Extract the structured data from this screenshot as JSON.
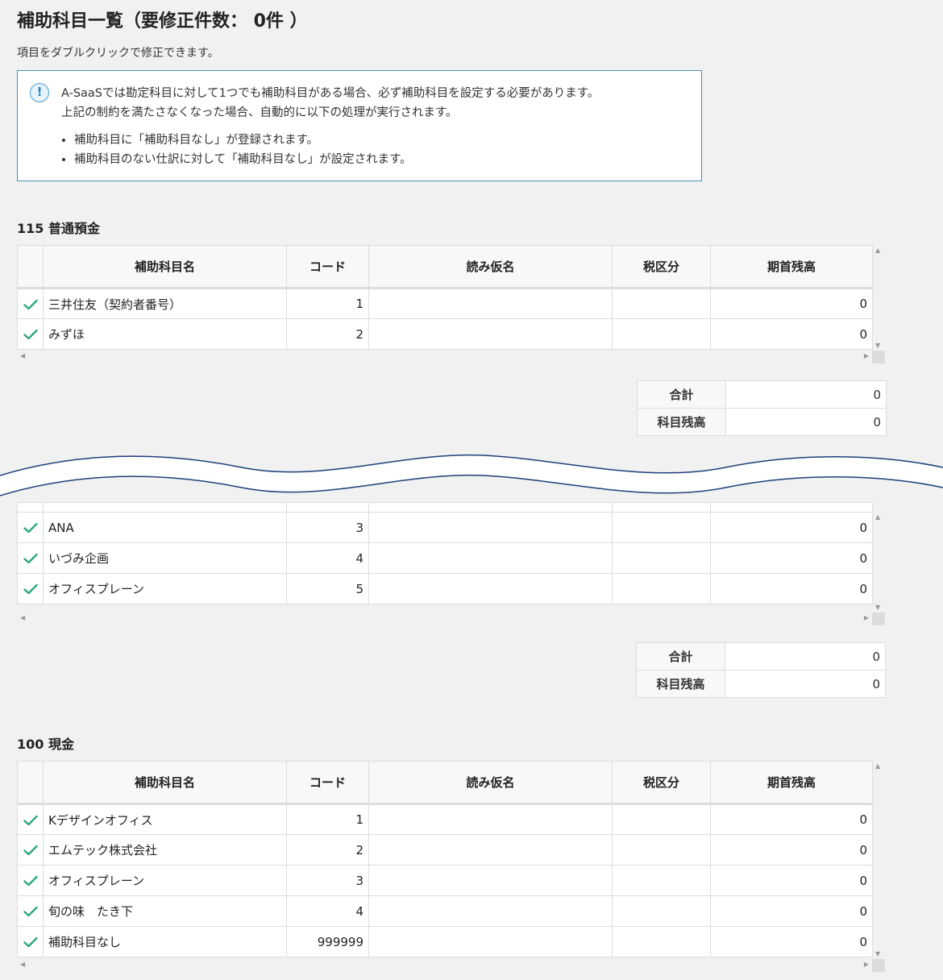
{
  "header": {
    "title": "補助科目一覧（要修正件数： 0件 ）",
    "subtitle": "項目をダブルクリックで修正できます。"
  },
  "notice": {
    "icon": "info-icon",
    "line1": "A-SaaSでは勘定科目に対して1つでも補助科目がある場合、必ず補助科目を設定する必要があります。",
    "line2": "上記の制約を満たさなくなった場合、自動的に以下の処理が実行されます。",
    "bullets": [
      "補助科目に「補助科目なし」が登録されます。",
      "補助科目のない仕訳に対して「補助科目なし」が設定されます。"
    ]
  },
  "columns": [
    "補助科目名",
    "コード",
    "読み仮名",
    "税区分",
    "期首残高"
  ],
  "colors": {
    "check": "#2aa87b",
    "border": "#dcdcdc",
    "wave": "#1e3f7a"
  },
  "sections": [
    {
      "title": "115 普通預金",
      "rows": [
        {
          "name": "三井住友（契約者番号）",
          "code": "1",
          "kana": "",
          "tax": "",
          "balance": "0"
        },
        {
          "name": "みずほ",
          "code": "2",
          "kana": "",
          "tax": "",
          "balance": "0"
        }
      ],
      "total_label": "合計",
      "total": "0",
      "balance_label": "科目残高",
      "balance": "0"
    },
    {
      "title": "",
      "rows": [
        {
          "name": "ANA",
          "code": "3",
          "kana": "",
          "tax": "",
          "balance": "0"
        },
        {
          "name": "いづみ企画",
          "code": "4",
          "kana": "",
          "tax": "",
          "balance": "0"
        },
        {
          "name": "オフィスプレーン",
          "code": "5",
          "kana": "",
          "tax": "",
          "balance": "0"
        }
      ],
      "total_label": "合計",
      "total": "0",
      "balance_label": "科目残高",
      "balance": "0"
    },
    {
      "title": "100 現金",
      "rows": [
        {
          "name": "Kデザインオフィス",
          "code": "1",
          "kana": "",
          "tax": "",
          "balance": "0"
        },
        {
          "name": "エムテック株式会社",
          "code": "2",
          "kana": "",
          "tax": "",
          "balance": "0"
        },
        {
          "name": "オフィスプレーン",
          "code": "3",
          "kana": "",
          "tax": "",
          "balance": "0"
        },
        {
          "name": "旬の味　たき下",
          "code": "4",
          "kana": "",
          "tax": "",
          "balance": "0"
        },
        {
          "name": "補助科目なし",
          "code": "999999",
          "kana": "",
          "tax": "",
          "balance": "0"
        }
      ]
    }
  ]
}
